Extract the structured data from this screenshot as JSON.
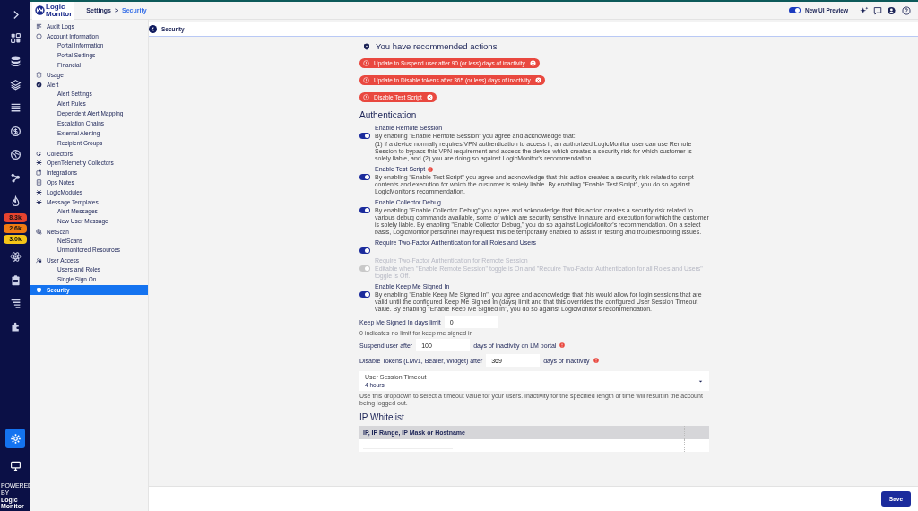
{
  "rail": {
    "items": [
      {
        "selected": false
      },
      {
        "selected": false
      },
      {
        "selected": false
      },
      {
        "selected": false
      },
      {
        "selected": false
      },
      {
        "selected": false
      },
      {
        "selected": false
      },
      {
        "selected": false
      },
      {
        "selected": false
      }
    ],
    "badges": [
      {
        "count": "8.3k",
        "color": "#e5432f"
      },
      {
        "count": "2.6k",
        "color": "#f07a12"
      },
      {
        "count": "3.0k",
        "color": "#f5c518"
      }
    ],
    "lower_items": [
      {
        "selected": false
      },
      {
        "selected": false
      },
      {
        "selected": false
      },
      {
        "selected": false
      }
    ],
    "bottom_items": [
      {
        "selected": true
      },
      {
        "selected": false
      }
    ],
    "powered_by": {
      "small": "POWERED BY",
      "line1": "Logic",
      "line2": "Monitor"
    }
  },
  "header": {
    "logo_line1": "Logic",
    "logo_line2": "Monitor",
    "breadcrumbs": [
      {
        "label": "Settings",
        "selected": false
      },
      {
        "label": "Security",
        "selected": true
      }
    ],
    "separator": ">",
    "preview_label": "New UI Preview",
    "preview_on": true
  },
  "sidebar": {
    "items": [
      {
        "label": "Audit Logs",
        "selected": false
      },
      {
        "label": "Account Information",
        "selected": false,
        "children": [
          {
            "label": "Portal Information",
            "selected": false
          },
          {
            "label": "Portal Settings",
            "selected": false
          },
          {
            "label": "Financial",
            "selected": false
          }
        ]
      },
      {
        "label": "Usage",
        "selected": false
      },
      {
        "label": "Alert",
        "selected": false,
        "children": [
          {
            "label": "Alert Settings",
            "selected": false
          },
          {
            "label": "Alert Rules",
            "selected": false
          },
          {
            "label": "Dependent Alert Mapping",
            "selected": false
          },
          {
            "label": "Escalation Chains",
            "selected": false
          },
          {
            "label": "External Alerting",
            "selected": false
          },
          {
            "label": "Recipient Groups",
            "selected": false
          }
        ]
      },
      {
        "label": "Collectors",
        "selected": false
      },
      {
        "label": "OpenTelemetry Collectors",
        "selected": false
      },
      {
        "label": "Integrations",
        "selected": false
      },
      {
        "label": "Ops Notes",
        "selected": false
      },
      {
        "label": "LogicModules",
        "selected": false
      },
      {
        "label": "Message Templates",
        "selected": false,
        "children": [
          {
            "label": "Alert Messages",
            "selected": false
          },
          {
            "label": "New User Message",
            "selected": false
          }
        ]
      },
      {
        "label": "NetScan",
        "selected": false,
        "children": [
          {
            "label": "NetScans",
            "selected": false
          },
          {
            "label": "Unmonitored Resources",
            "selected": false
          }
        ]
      },
      {
        "label": "User Access",
        "selected": false,
        "children": [
          {
            "label": "Users and Roles",
            "selected": false
          },
          {
            "label": "Single Sign On",
            "selected": false
          }
        ]
      },
      {
        "label": "Security",
        "selected": true
      }
    ]
  },
  "page_title": "Security",
  "recommendations": {
    "title": "You have recommended actions",
    "chips": [
      "Update to Suspend user after 90 (or less) days of inactivity",
      "Update to Disable tokens after 365 (or less) days of inactivity",
      "Disable Test Script"
    ]
  },
  "authentication": {
    "title": "Authentication",
    "toggles": [
      {
        "label": "Enable Remote Session",
        "on": true,
        "disabled": false,
        "description": [
          "By enabling \"Enable Remote Session\" you agree and acknowledge that:",
          "(1) if a device normally requires VPN authentication to access it, an authorized LogicMonitor user can use Remote Session to bypass this VPN requirement and access the device which creates a security risk for which customer is solely liable, and (2) you are doing so against LogicMonitor's recommendation."
        ]
      },
      {
        "label": "Enable Test Script",
        "on": true,
        "disabled": false,
        "warning": true,
        "description": [
          "By enabling \"Enable Test Script\" you agree and acknowledge that this action creates a security risk related to script contents and execution for which the customer is solely liable. By enabling \"Enable Test Script\", you do so against LogicMonitor's recommendation."
        ]
      },
      {
        "label": "Enable Collector Debug",
        "on": true,
        "disabled": false,
        "description": [
          "By enabling \"Enable Collector Debug\" you agree and acknowledge that this action creates a security risk related to various debug commands available, some of which are security sensitive in nature and execution for which the customer is solely liable. By enabling \"Enable Collector Debug,\" you do so against LogicMonitor's recommendation. On a select basis, LogicMonitor personnel may request this be temporarily enabled to assist in testing and troubleshooting issues."
        ]
      },
      {
        "label": "Require Two-Factor Authentication for all Roles and Users",
        "on": true,
        "disabled": false
      },
      {
        "label": "Require Two-Factor Authentication for Remote Session",
        "on": true,
        "disabled": true,
        "description": [
          "Editable when \"Enable Remote Session\" toggle is On and \"Require Two-Factor Authentication for all Roles and Users\" toggle is Off."
        ]
      },
      {
        "label": "Enable Keep Me Signed In",
        "on": true,
        "disabled": false,
        "description": [
          "By enabling \"Enable Keep Me Signed In\", you agree and acknowledge that this would allow for login sessions that are valid until the configured Keep Me Signed In (days) limit and that this overrides the configured User Session Timeout value. By enabling \"Enable Keep Me Signed In\", you do so against LogicMonitor's recommendation."
        ]
      }
    ],
    "keep_signed_in": {
      "label": "Keep Me Signed In days limit",
      "value": "0",
      "hint": "0 indicates no limit for keep me signed in"
    },
    "suspend": {
      "before": "Suspend user after",
      "value": "100",
      "after": "days of inactivity on LM portal",
      "warning": true
    },
    "tokens": {
      "before": "Disable Tokens (LMv1, Bearer, Widget) after",
      "value": "369",
      "after": "days of inactivity",
      "warning": true
    },
    "session_timeout": {
      "label": "User Session Timeout",
      "value": "4 hours",
      "hint": "Use this dropdown to select a timeout value for your users. Inactivity for the specified length of time will result in the account being logged out."
    }
  },
  "ip_whitelist": {
    "title": "IP Whitelist",
    "columns": [
      "IP, IP Range, IP Mask or Hostname"
    ]
  },
  "save_button": "Save"
}
